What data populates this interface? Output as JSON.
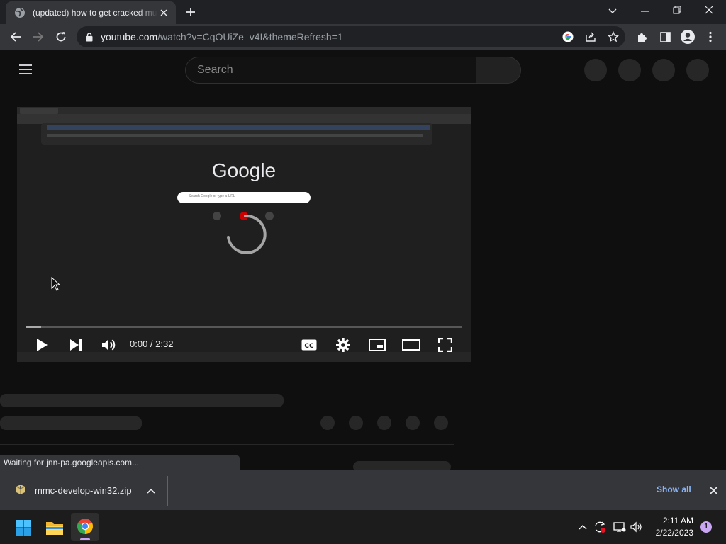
{
  "browser": {
    "tab": {
      "title": "(updated) how to get cracked mu",
      "globe_icon": "globe-icon",
      "close_icon": "close-icon"
    },
    "new_tab_icon": "plus-icon",
    "window_controls": [
      "chevron-down-icon",
      "minimize-icon",
      "restore-icon",
      "close-icon"
    ],
    "nav": [
      "back-icon",
      "forward-icon",
      "reload-icon"
    ],
    "address": {
      "host": "youtube.com",
      "path": "/watch?v=CqOUiZe_v4I&themeRefresh=1"
    },
    "toolbar_icons": [
      "google-icon",
      "share-icon",
      "star-icon",
      "extensions-icon",
      "side-panel-icon",
      "profile-icon",
      "more-icon"
    ]
  },
  "youtube": {
    "search_placeholder": "Search",
    "menu_icon": "hamburger-menu-icon",
    "player": {
      "time": "0:00 / 2:32",
      "progress": 0.035,
      "inner_logo": "Google",
      "inner_search_placeholder": "Search Google or type a URL"
    }
  },
  "status_text": "Waiting for jnn-pa.googleapis.com...",
  "download_shelf": {
    "file_name": "mmc-develop-win32.zip",
    "show_all": "Show all"
  },
  "taskbar": {
    "apps": [
      "windows-start-icon",
      "file-explorer-icon",
      "chrome-icon"
    ],
    "time": "2:11 AM",
    "date": "2/22/2023",
    "notification_count": "1"
  },
  "colors": {
    "accent_link": "#8ab4f8",
    "chrome_dark": "#35363a",
    "yt_bg": "#0f0f0f"
  }
}
